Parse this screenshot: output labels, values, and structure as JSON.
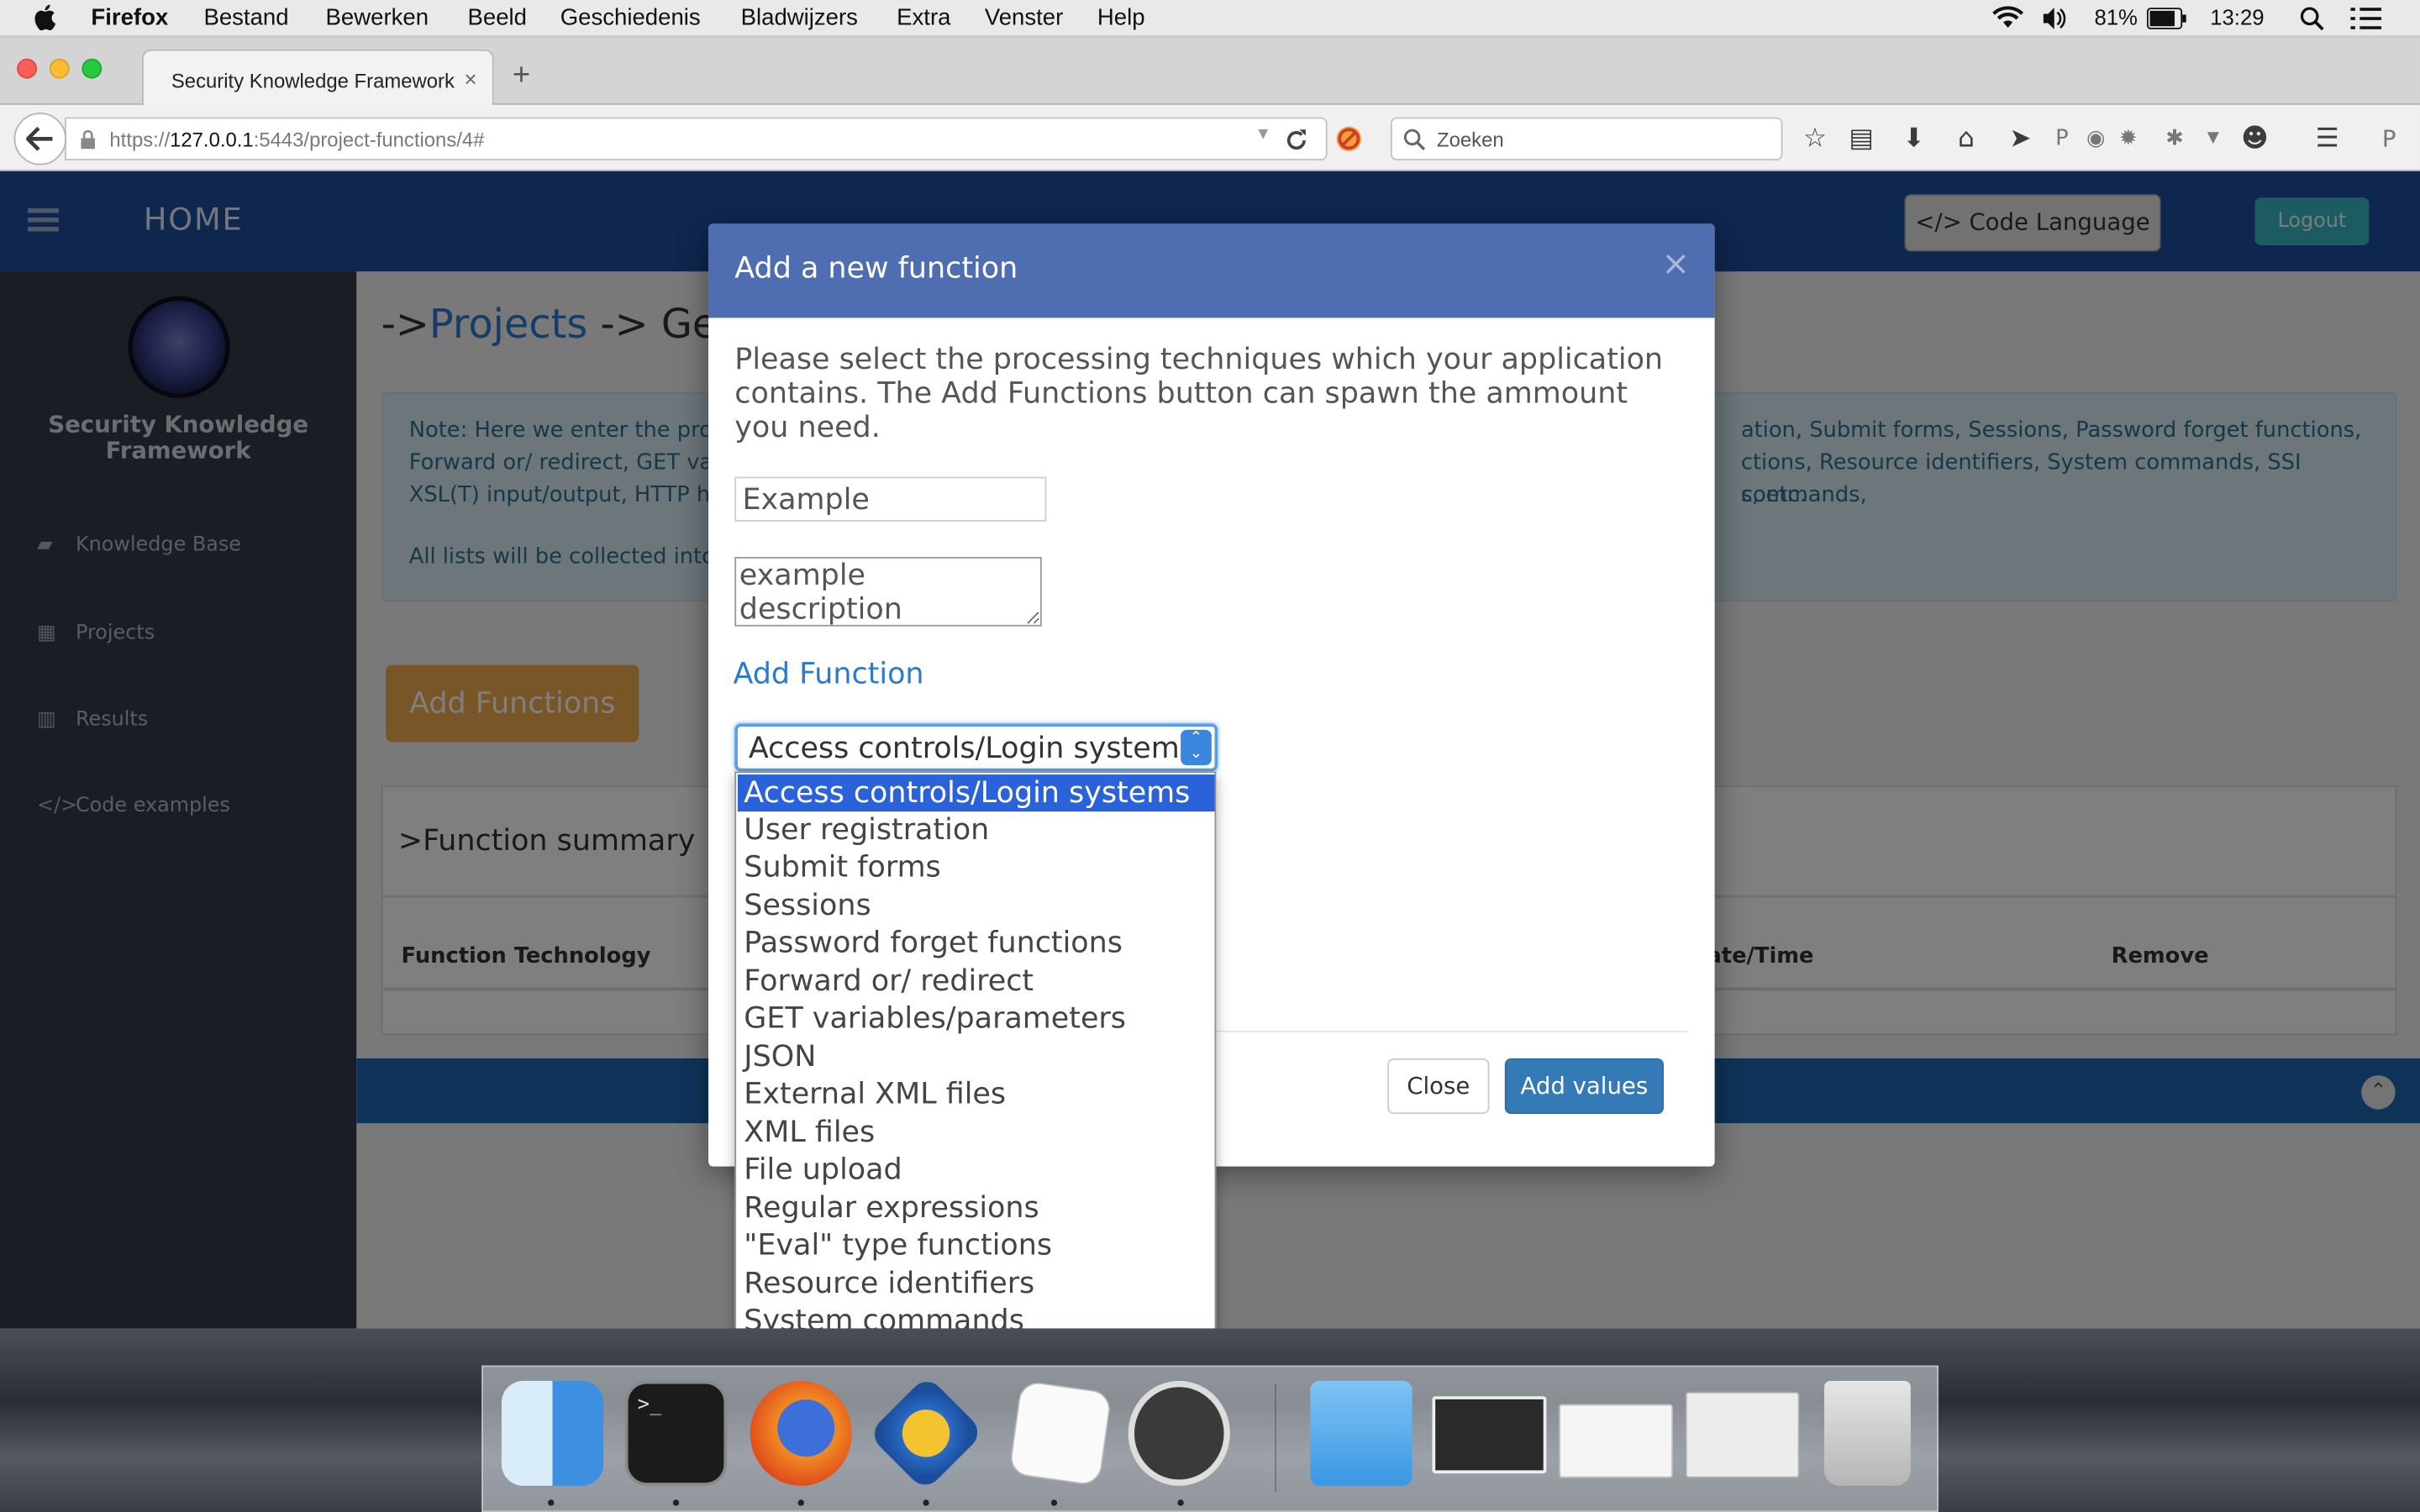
{
  "menubar": {
    "app_name": "Firefox",
    "items": [
      "Bestand",
      "Bewerken",
      "Beeld",
      "Geschiedenis",
      "Bladwijzers",
      "Extra",
      "Venster",
      "Help"
    ],
    "battery": "81%",
    "clock": "13:29"
  },
  "browser": {
    "tab_title": "Security Knowledge Framework",
    "url_prefix": "https://",
    "url_host": "127.0.0.1",
    "url_rest": ":5443/project-functions/4#",
    "search_placeholder": "Zoeken"
  },
  "app": {
    "nav_home": "HOME",
    "code_language": "</> Code Language ▾",
    "logout": "Logout",
    "brand_line1": "Security Knowledge",
    "brand_line2": "Framework",
    "sidebar": [
      "Knowledge Base",
      "Projects",
      "Results",
      "Code examples"
    ],
    "crumb_prefix": "->",
    "crumb_link": "Projects",
    "crumb_rest": " -> Getti",
    "note_left": [
      "Note: Here we enter the proce",
      "Forward or/ redirect, GET varia",
      "XSL(T) input/output, HTTP head",
      "",
      "All lists will be collected into a"
    ],
    "note_right": [
      "ation, Submit forms, Sessions, Password forget functions,",
      "ctions, Resource identifiers, System commands, SSI commands,",
      "s, etc."
    ],
    "add_functions_button": "Add Functions",
    "summary_title": ">Function summary",
    "table_headers": [
      "Function Technology",
      "ate/Time",
      "Remove"
    ]
  },
  "modal": {
    "title": "Add a new function",
    "close_x": "×",
    "description": "Please select the processing techniques which your application contains. The Add Functions button can spawn the ammount you need.",
    "name_value": "Example",
    "description_value": "example description",
    "add_function_link": "Add Function",
    "select_value": "Access controls/Login systems",
    "close_button": "Close",
    "add_values_button": "Add values"
  },
  "dropdown_options": [
    "Access controls/Login systems",
    "User registration",
    "Submit forms",
    "Sessions",
    "Password forget functions",
    "Forward or/ redirect",
    "GET variables/parameters",
    "JSON",
    "External XML files",
    "XML files",
    "File upload",
    "Regular expressions",
    "\"Eval\" type functions",
    "Resource identifiers",
    "System commands"
  ],
  "dock_apps": [
    "finder-icon",
    "terminal-icon",
    "firefox-icon",
    "wireshark-icon",
    "textedit-icon",
    "mamp-icon",
    "folder-icon",
    "window-thumbnail",
    "document-thumbnail",
    "mamp-window-thumbnail",
    "trash-icon"
  ],
  "colors": {
    "nav": "#1f4d9f",
    "modal_header": "#4f6eb1",
    "primary": "#337ab7",
    "warning": "#f0ad4e",
    "selected_option": "#2a62d9"
  }
}
